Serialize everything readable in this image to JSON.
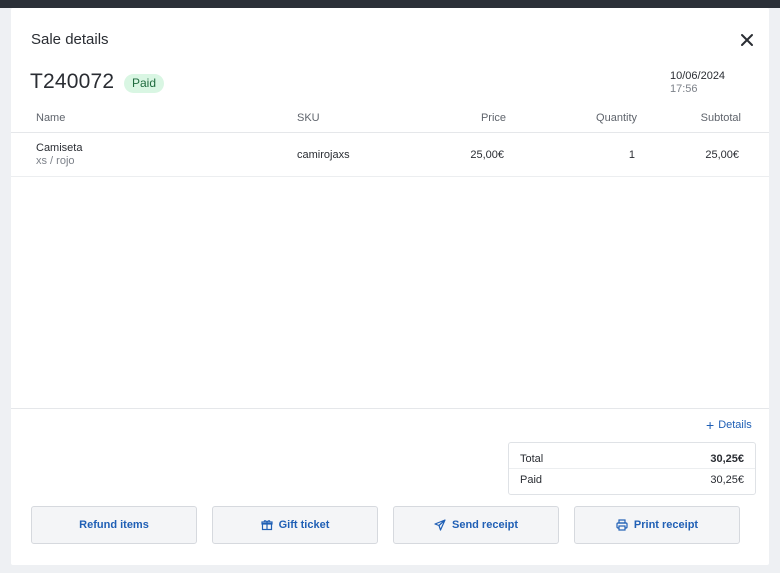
{
  "header": {
    "title": "Sale details",
    "close_icon": "close-icon"
  },
  "order": {
    "id": "T240072",
    "status": "Paid",
    "date": "10/06/2024",
    "time": "17:56"
  },
  "table": {
    "columns": [
      "Name",
      "SKU",
      "Price",
      "Quantity",
      "Subtotal"
    ],
    "rows": [
      {
        "name": "Camiseta",
        "variant": "xs / rojo",
        "sku": "camirojaxs",
        "price": "25,00€",
        "quantity": "1",
        "subtotal": "25,00€"
      }
    ]
  },
  "details_link": "Details",
  "totals": {
    "total_label": "Total",
    "total_value": "30,25€",
    "paid_label": "Paid",
    "paid_value": "30,25€"
  },
  "actions": {
    "refund": "Refund items",
    "gift": "Gift ticket",
    "send": "Send receipt",
    "print": "Print receipt"
  },
  "colors": {
    "accent": "#1f5fb5",
    "badge_bg": "#d9f6e3",
    "badge_text": "#1f6b3e"
  }
}
